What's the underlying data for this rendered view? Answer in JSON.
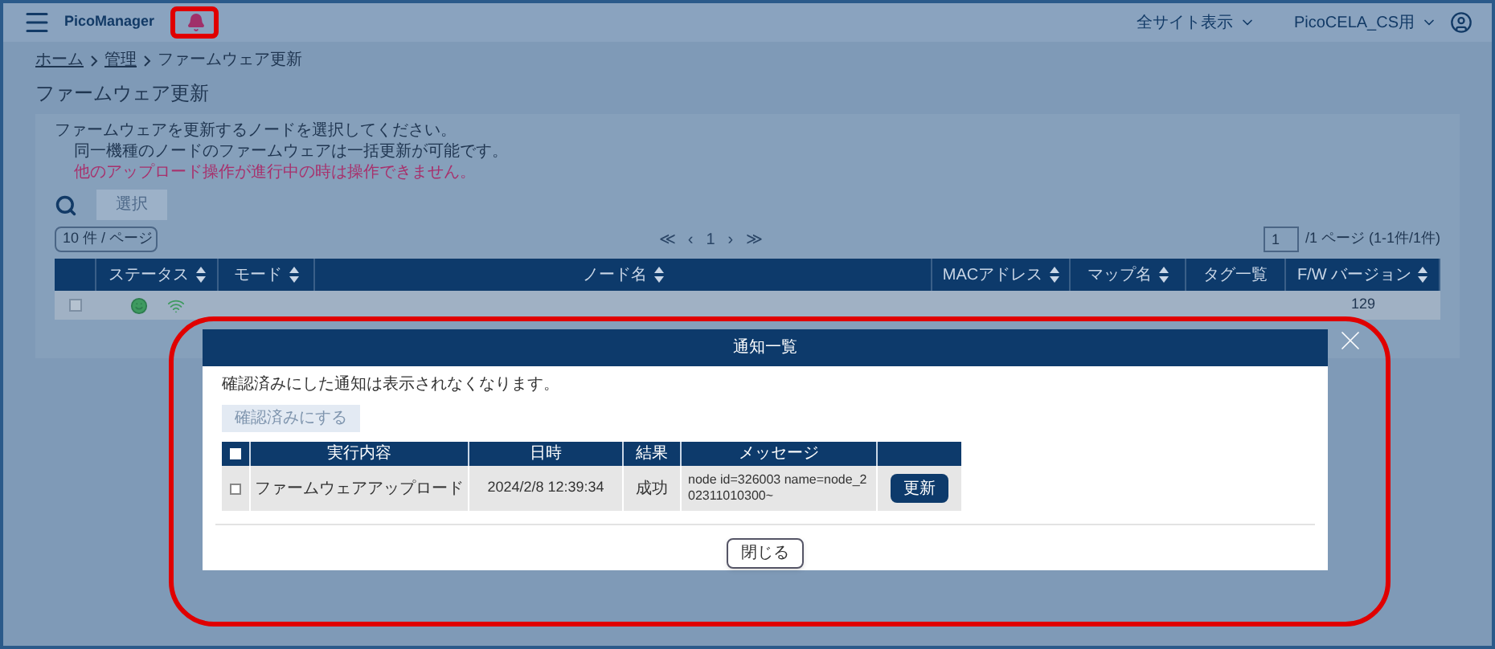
{
  "header": {
    "app_name": "PicoManager",
    "site_selector": "全サイト表示",
    "user_menu": "PicoCELA_CS用"
  },
  "breadcrumb": [
    "ホーム",
    "管理",
    "ファームウェア更新"
  ],
  "page_title": "ファームウェア更新",
  "instructions": [
    {
      "kind": "normal",
      "text": "ファームウェアを更新するノードを選択してください。"
    },
    {
      "kind": "note",
      "text": "同一機種のノードのファームウェアは一括更新が可能です。"
    },
    {
      "kind": "warning",
      "text": "他のアップロード操作が進行中の時は操作できません。"
    }
  ],
  "select_button": {
    "label": "選択",
    "disabled": true
  },
  "per_page": "10 件 / ページ",
  "pager": {
    "first": "≪",
    "prev": "‹",
    "current": "1",
    "next": "›",
    "last": "≫"
  },
  "page_input": "1",
  "page_info": "/1 ページ (1-1件/1件)",
  "table": {
    "columns": [
      {
        "label": "ステータス",
        "sortable": true
      },
      {
        "label": "モード",
        "sortable": true
      },
      {
        "label": "ノード名",
        "sortable": true
      },
      {
        "label": "MACアドレス",
        "sortable": true
      },
      {
        "label": "マップ名",
        "sortable": true
      },
      {
        "label": "タグ一覧",
        "sortable": false
      },
      {
        "label": "F/W バージョン",
        "sortable": true
      }
    ],
    "rows": [
      {
        "checked": false,
        "fw_version": "129"
      }
    ]
  },
  "modal": {
    "title": "通知一覧",
    "note": "確認済みにした通知は表示されなくなります。",
    "mark_read_button": {
      "label": "確認済みにする",
      "disabled": true
    },
    "columns": [
      "実行内容",
      "日時",
      "結果",
      "メッセージ"
    ],
    "select_all_checked": false,
    "rows": [
      {
        "checked": false,
        "action": "ファームウェアアップロード",
        "datetime": "2024/2/8 12:39:34",
        "result": "成功",
        "message": "node id=326003 name=node_202311010300~",
        "button": "更新"
      }
    ],
    "close_button": "閉じる"
  }
}
